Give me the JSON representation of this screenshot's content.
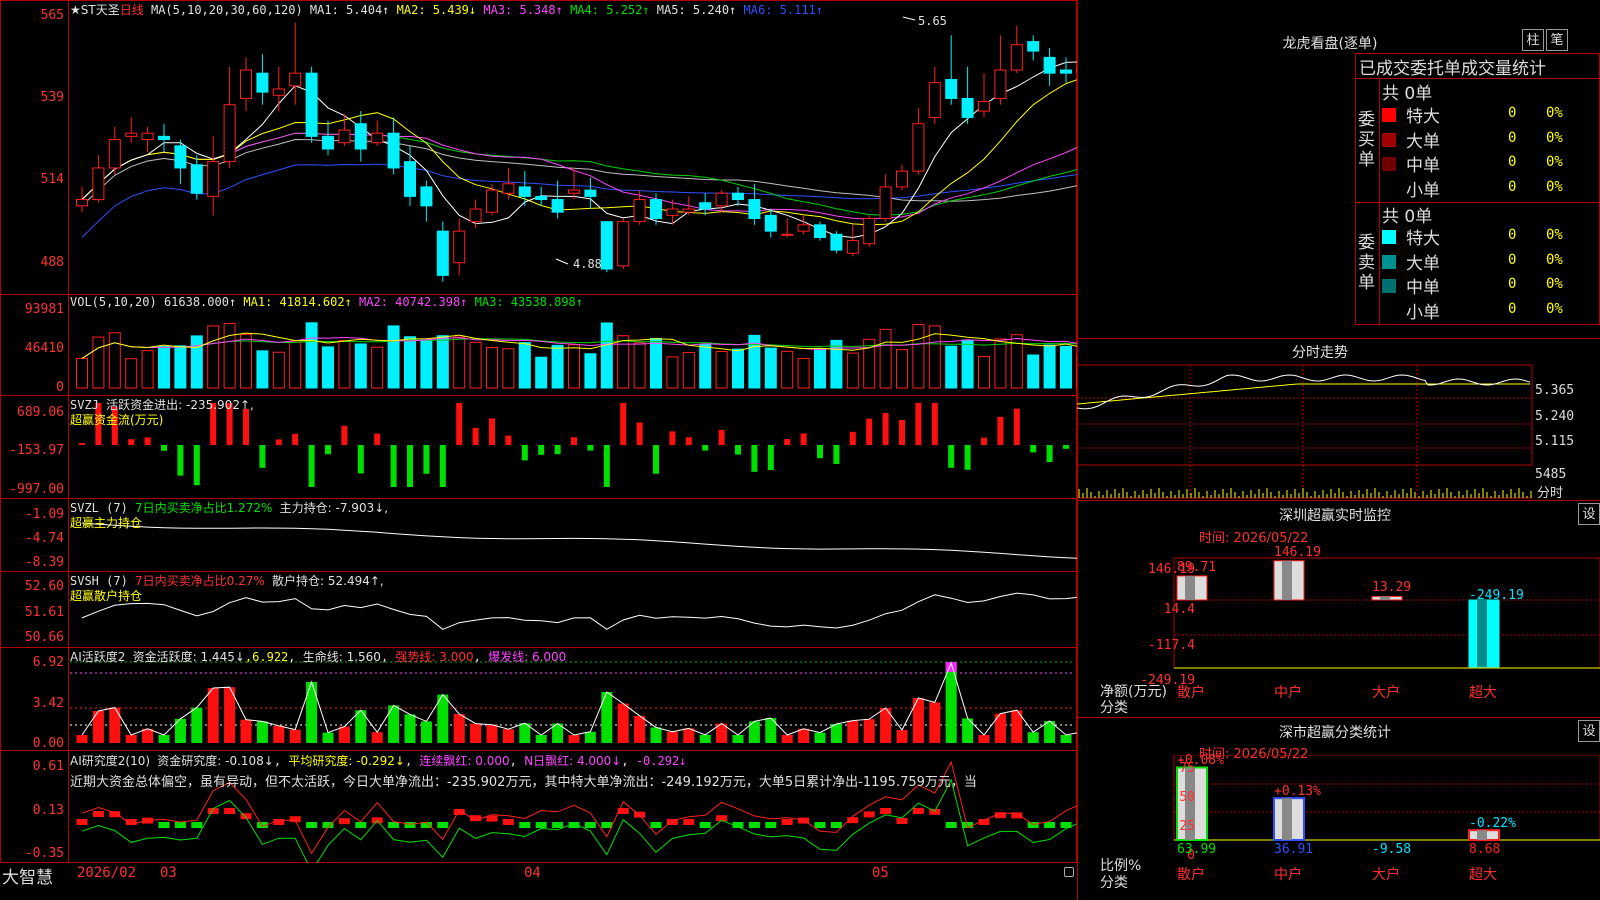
{
  "main": {
    "header": {
      "name": "★ST天圣",
      "period": "日线",
      "ma_def": "MA(5,10,20,30,60,120)",
      "ma1": "MA1: 5.404↑",
      "ma2": "MA2: 5.439↓",
      "ma3": "MA3: 5.348↑",
      "ma4": "MA4: 5.252↑",
      "ma5": "MA5: 5.240↑",
      "ma6": "MA6: 5.111↑"
    },
    "y_ticks": [
      "565",
      "539",
      "514",
      "488"
    ],
    "hi_label": "5.65",
    "lo_label": "4.88"
  },
  "vol": {
    "header": {
      "def": "VOL(5,10,20)",
      "v": "61638.000↑",
      "ma1": "MA1: 41814.602↑",
      "ma2": "MA2: 40742.398↑",
      "ma3": "MA3: 43538.898↑"
    },
    "y_ticks": [
      "93981",
      "46410",
      "0"
    ]
  },
  "svzj": {
    "header": {
      "def": "SVZJ",
      "line": "活跃资金进出: -235.902↑,",
      "sub": "超赢资金流(万元)"
    },
    "y_ticks": [
      "689.06",
      "-153.97",
      "-997.00"
    ]
  },
  "svzl": {
    "header": {
      "def": "SVZL (7)",
      "a": "7日内买卖净占比1.272%",
      "b": "主力持仓: -7.903↓,",
      "sub": "超赢主力持仓"
    },
    "y_ticks": [
      "-1.09",
      "-4.74",
      "-8.39"
    ]
  },
  "svsh": {
    "header": {
      "def": "SVSH (7)",
      "a": "7日内买卖净占比0.27%",
      "b": "散户持仓: 52.494↑,",
      "sub": "超赢散户持仓"
    },
    "y_ticks": [
      "52.60",
      "51.61",
      "50.66"
    ]
  },
  "ai1": {
    "header": {
      "def": "AI活跃度2",
      "a": "资金活跃度: 1.445↓",
      "b": "6.922",
      "c": "生命线: 1.560",
      "d": "强势线: 3.000",
      "e": "爆发线: 6.000"
    },
    "y_ticks": [
      "6.92",
      "3.42",
      "0.00"
    ]
  },
  "ai2": {
    "header": {
      "def": "AI研究度2(10)",
      "a": "资金研究度: -0.108↓",
      "b": "平均研究度: -0.292↓",
      "c": "连续飘红: 0.000",
      "d": "N日飘红: 4.000↓",
      "e": "-0.292↓"
    },
    "text": "近期大资金总体偏空，虽有异动，但不太活跃，今日大单净流出：-235.902万元，其中特大单净流出：-249.192万元，大单5日累计净出-1195.759万元，当",
    "y_ticks": [
      "0.61",
      "0.13",
      "-0.35"
    ]
  },
  "xaxis": {
    "logo": "大智慧",
    "labels": [
      "2026/02",
      "03",
      "04",
      "05"
    ]
  },
  "panel_lhb": {
    "title": "龙虎看盘(逐单)",
    "btn1": "柱",
    "btn2": "笔",
    "table_header": "已成交委托单成交量统计",
    "buy_label": "委买单",
    "sell_label": "委卖单",
    "buy_total": "共 0单",
    "sell_total": "共 0单",
    "buy_rows": [
      {
        "name": "特大",
        "count": "0",
        "pct": "0%",
        "color": "#ff0000"
      },
      {
        "name": "大单",
        "count": "0",
        "pct": "0%",
        "color": "#a00000"
      },
      {
        "name": "中单",
        "count": "0",
        "pct": "0%",
        "color": "#700000"
      },
      {
        "name": "小单",
        "count": "0",
        "pct": "0%",
        "color": "#000000"
      }
    ],
    "sell_rows": [
      {
        "name": "特大",
        "count": "0",
        "pct": "0%",
        "color": "#00ffff"
      },
      {
        "name": "大单",
        "count": "0",
        "pct": "0%",
        "color": "#009090"
      },
      {
        "name": "中单",
        "count": "0",
        "pct": "0%",
        "color": "#007070"
      },
      {
        "name": "小单",
        "count": "0",
        "pct": "0%",
        "color": "#000000"
      }
    ]
  },
  "panel_fs": {
    "title": "分时走势",
    "y_ticks": [
      "5.365",
      "5.240",
      "5.115",
      "5485"
    ],
    "foot": "分时"
  },
  "panel_sz": {
    "title": "深圳超赢实时监控",
    "btn": "设",
    "time": "时间: 2026/05/22",
    "y_ticks": [
      "146.19",
      "14.4",
      "-117.4",
      "-249.19"
    ],
    "ylabel": "净额(万元)",
    "xlabel": "分类",
    "categories": [
      "散户",
      "中户",
      "大户",
      "超大"
    ],
    "values": [
      "89.71",
      "146.19",
      "13.29",
      "-249.19"
    ]
  },
  "panel_fl": {
    "title": "深市超赢分类统计",
    "btn": "设",
    "time": "时间: 2026/05/22",
    "y_ticks": [
      "75",
      "50",
      "25",
      "0"
    ],
    "ylabel": "比例%",
    "xlabel": "分类",
    "categories": [
      "散户",
      "中户",
      "大户",
      "超大"
    ],
    "top_labels": [
      "+0.08%",
      "+0.13%",
      "",
      "-0.22%"
    ],
    "bottom_labels": [
      "63.99",
      "36.91",
      "-9.58",
      "8.68"
    ]
  },
  "chart_data": {
    "type": "candlestick",
    "dates": [
      "2026/02",
      "03",
      "04",
      "05"
    ],
    "price_ylim": [
      4.88,
      5.65
    ],
    "ohlc": [
      [
        5.08,
        5.1,
        5.14,
        5.06
      ],
      [
        5.1,
        5.2,
        5.24,
        5.09
      ],
      [
        5.2,
        5.29,
        5.33,
        5.18
      ],
      [
        5.3,
        5.31,
        5.36,
        5.28
      ],
      [
        5.29,
        5.31,
        5.33,
        5.25
      ],
      [
        5.3,
        5.29,
        5.34,
        5.25
      ],
      [
        5.27,
        5.2,
        5.29,
        5.15
      ],
      [
        5.21,
        5.12,
        5.24,
        5.1
      ],
      [
        5.11,
        5.22,
        5.3,
        5.05
      ],
      [
        5.22,
        5.4,
        5.52,
        5.2
      ],
      [
        5.42,
        5.51,
        5.55,
        5.38
      ],
      [
        5.5,
        5.44,
        5.56,
        5.4
      ],
      [
        5.43,
        5.45,
        5.52,
        5.38
      ],
      [
        5.46,
        5.5,
        5.66,
        5.4
      ],
      [
        5.5,
        5.3,
        5.52,
        5.28
      ],
      [
        5.3,
        5.26,
        5.35,
        5.24
      ],
      [
        5.28,
        5.32,
        5.37,
        5.27
      ],
      [
        5.34,
        5.26,
        5.38,
        5.22
      ],
      [
        5.28,
        5.31,
        5.35,
        5.27
      ],
      [
        5.31,
        5.2,
        5.36,
        5.18
      ],
      [
        5.22,
        5.11,
        5.27,
        5.08
      ],
      [
        5.14,
        5.08,
        5.16,
        5.03
      ],
      [
        5.0,
        4.86,
        5.03,
        4.84
      ],
      [
        4.9,
        5.0,
        5.04,
        4.86
      ],
      [
        5.03,
        5.07,
        5.1,
        5.01
      ],
      [
        5.06,
        5.13,
        5.15,
        5.05
      ],
      [
        5.12,
        5.15,
        5.2,
        5.1
      ],
      [
        5.14,
        5.11,
        5.19,
        5.08
      ],
      [
        5.11,
        5.1,
        5.14,
        5.08
      ],
      [
        5.1,
        5.06,
        5.16,
        5.04
      ],
      [
        5.12,
        5.13,
        5.2,
        5.1
      ],
      [
        5.13,
        5.11,
        5.17,
        5.07
      ],
      [
        5.03,
        4.88,
        5.03,
        4.87
      ],
      [
        4.89,
        5.03,
        5.04,
        4.88
      ],
      [
        5.03,
        5.1,
        5.13,
        5.02
      ],
      [
        5.1,
        5.04,
        5.12,
        5.02
      ],
      [
        5.05,
        5.07,
        5.1,
        5.02
      ],
      [
        5.06,
        5.07,
        5.11,
        5.05
      ],
      [
        5.09,
        5.07,
        5.12,
        5.05
      ],
      [
        5.08,
        5.12,
        5.13,
        5.06
      ],
      [
        5.12,
        5.1,
        5.14,
        5.08
      ],
      [
        5.1,
        5.04,
        5.15,
        5.02
      ],
      [
        5.05,
        5.0,
        5.07,
        4.98
      ],
      [
        4.99,
        4.99,
        5.04,
        4.98
      ],
      [
        5.0,
        5.02,
        5.05,
        4.99
      ],
      [
        5.02,
        4.98,
        5.03,
        4.97
      ],
      [
        4.99,
        4.94,
        5.0,
        4.93
      ],
      [
        4.93,
        4.97,
        5.02,
        4.92
      ],
      [
        4.96,
        5.04,
        5.05,
        4.95
      ],
      [
        5.04,
        5.14,
        5.18,
        5.03
      ],
      [
        5.14,
        5.19,
        5.21,
        5.13
      ],
      [
        5.19,
        5.34,
        5.39,
        5.18
      ],
      [
        5.36,
        5.47,
        5.52,
        5.34
      ],
      [
        5.48,
        5.42,
        5.62,
        5.4
      ],
      [
        5.42,
        5.36,
        5.52,
        5.34
      ],
      [
        5.38,
        5.41,
        5.5,
        5.36
      ],
      [
        5.42,
        5.51,
        5.62,
        5.4
      ],
      [
        5.51,
        5.59,
        5.65,
        5.5
      ],
      [
        5.6,
        5.57,
        5.62,
        5.54
      ],
      [
        5.55,
        5.5,
        5.58,
        5.46
      ],
      [
        5.51,
        5.5,
        5.55,
        5.47
      ],
      [
        5.5,
        5.52,
        5.56,
        5.47
      ],
      [
        5.52,
        5.43,
        5.58,
        5.38
      ],
      [
        5.43,
        5.38,
        5.47,
        5.36
      ],
      [
        5.38,
        5.49,
        5.53,
        5.36
      ],
      [
        5.48,
        5.47,
        5.55,
        5.44
      ],
      [
        5.49,
        5.45,
        5.51,
        5.41
      ],
      [
        5.46,
        5.3,
        5.48,
        5.28
      ],
      [
        5.3,
        5.4,
        5.45,
        5.26
      ]
    ]
  }
}
